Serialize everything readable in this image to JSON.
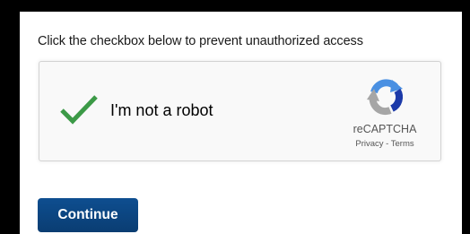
{
  "prompt_text": "Click the checkbox below to prevent unauthorized access",
  "captcha": {
    "checkbox_label": "I'm not a robot",
    "checked": true,
    "check_color": "#3c9a47",
    "brand_name": "reCAPTCHA",
    "legal_links": "Privacy - Terms",
    "icon": "recaptcha-logo-icon"
  },
  "actions": {
    "continue_label": "Continue",
    "continue_color": "#0b4680"
  }
}
